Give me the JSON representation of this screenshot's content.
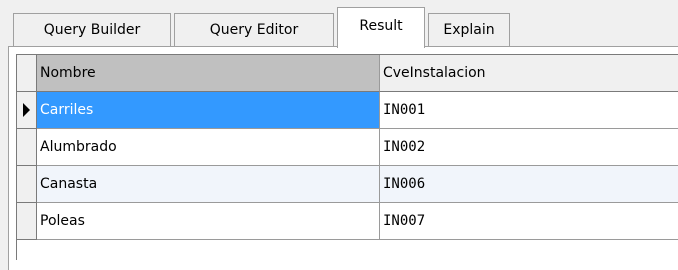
{
  "tabs": [
    {
      "label": "Query Builder",
      "active": false
    },
    {
      "label": "Query Editor",
      "active": false
    },
    {
      "label": "Result",
      "active": true
    },
    {
      "label": "Explain",
      "active": false
    }
  ],
  "grid": {
    "columns": [
      "Nombre",
      "CveInstalacion"
    ],
    "rows": [
      {
        "nombre": "Carriles",
        "cve": "IN001",
        "selected": true
      },
      {
        "nombre": "Alumbrado",
        "cve": "IN002",
        "selected": false
      },
      {
        "nombre": "Canasta",
        "cve": "IN006",
        "selected": false
      },
      {
        "nombre": "Poleas",
        "cve": "IN007",
        "selected": false
      }
    ],
    "current_row_indicator": "row-pointer-icon"
  },
  "colors": {
    "selection": "#3399ff",
    "alt_row": "#f1f5fb",
    "sorted_header": "#c0c0c0"
  }
}
